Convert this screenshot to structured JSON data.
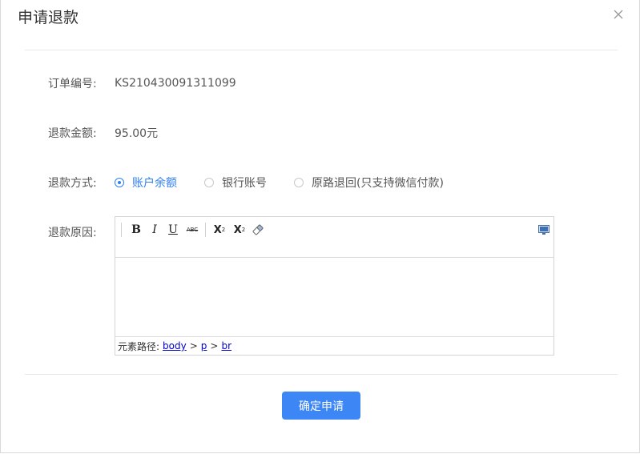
{
  "dialog": {
    "title": "申请退款"
  },
  "form": {
    "order_label": "订单编号:",
    "order_value": "KS210430091311099",
    "amount_label": "退款金额:",
    "amount_value": "95.00元",
    "method_label": "退款方式:",
    "methods": [
      {
        "label": "账户余额",
        "checked": true
      },
      {
        "label": "银行账号",
        "checked": false
      },
      {
        "label": "原路退回(只支持微信付款)",
        "checked": false
      }
    ],
    "reason_label": "退款原因:"
  },
  "editor": {
    "toolbar": {
      "bold": "B",
      "italic": "I",
      "underline": "U",
      "strike": "ABC",
      "superscript": "X",
      "superscript_mark": "2",
      "subscript": "X",
      "subscript_mark": "2"
    },
    "path_label": "元素路径:",
    "path": [
      "body",
      "p",
      "br"
    ]
  },
  "actions": {
    "submit_label": "确定申请"
  },
  "colors": {
    "accent": "#3c86f5",
    "radio_checked": "#2f7ff5"
  }
}
